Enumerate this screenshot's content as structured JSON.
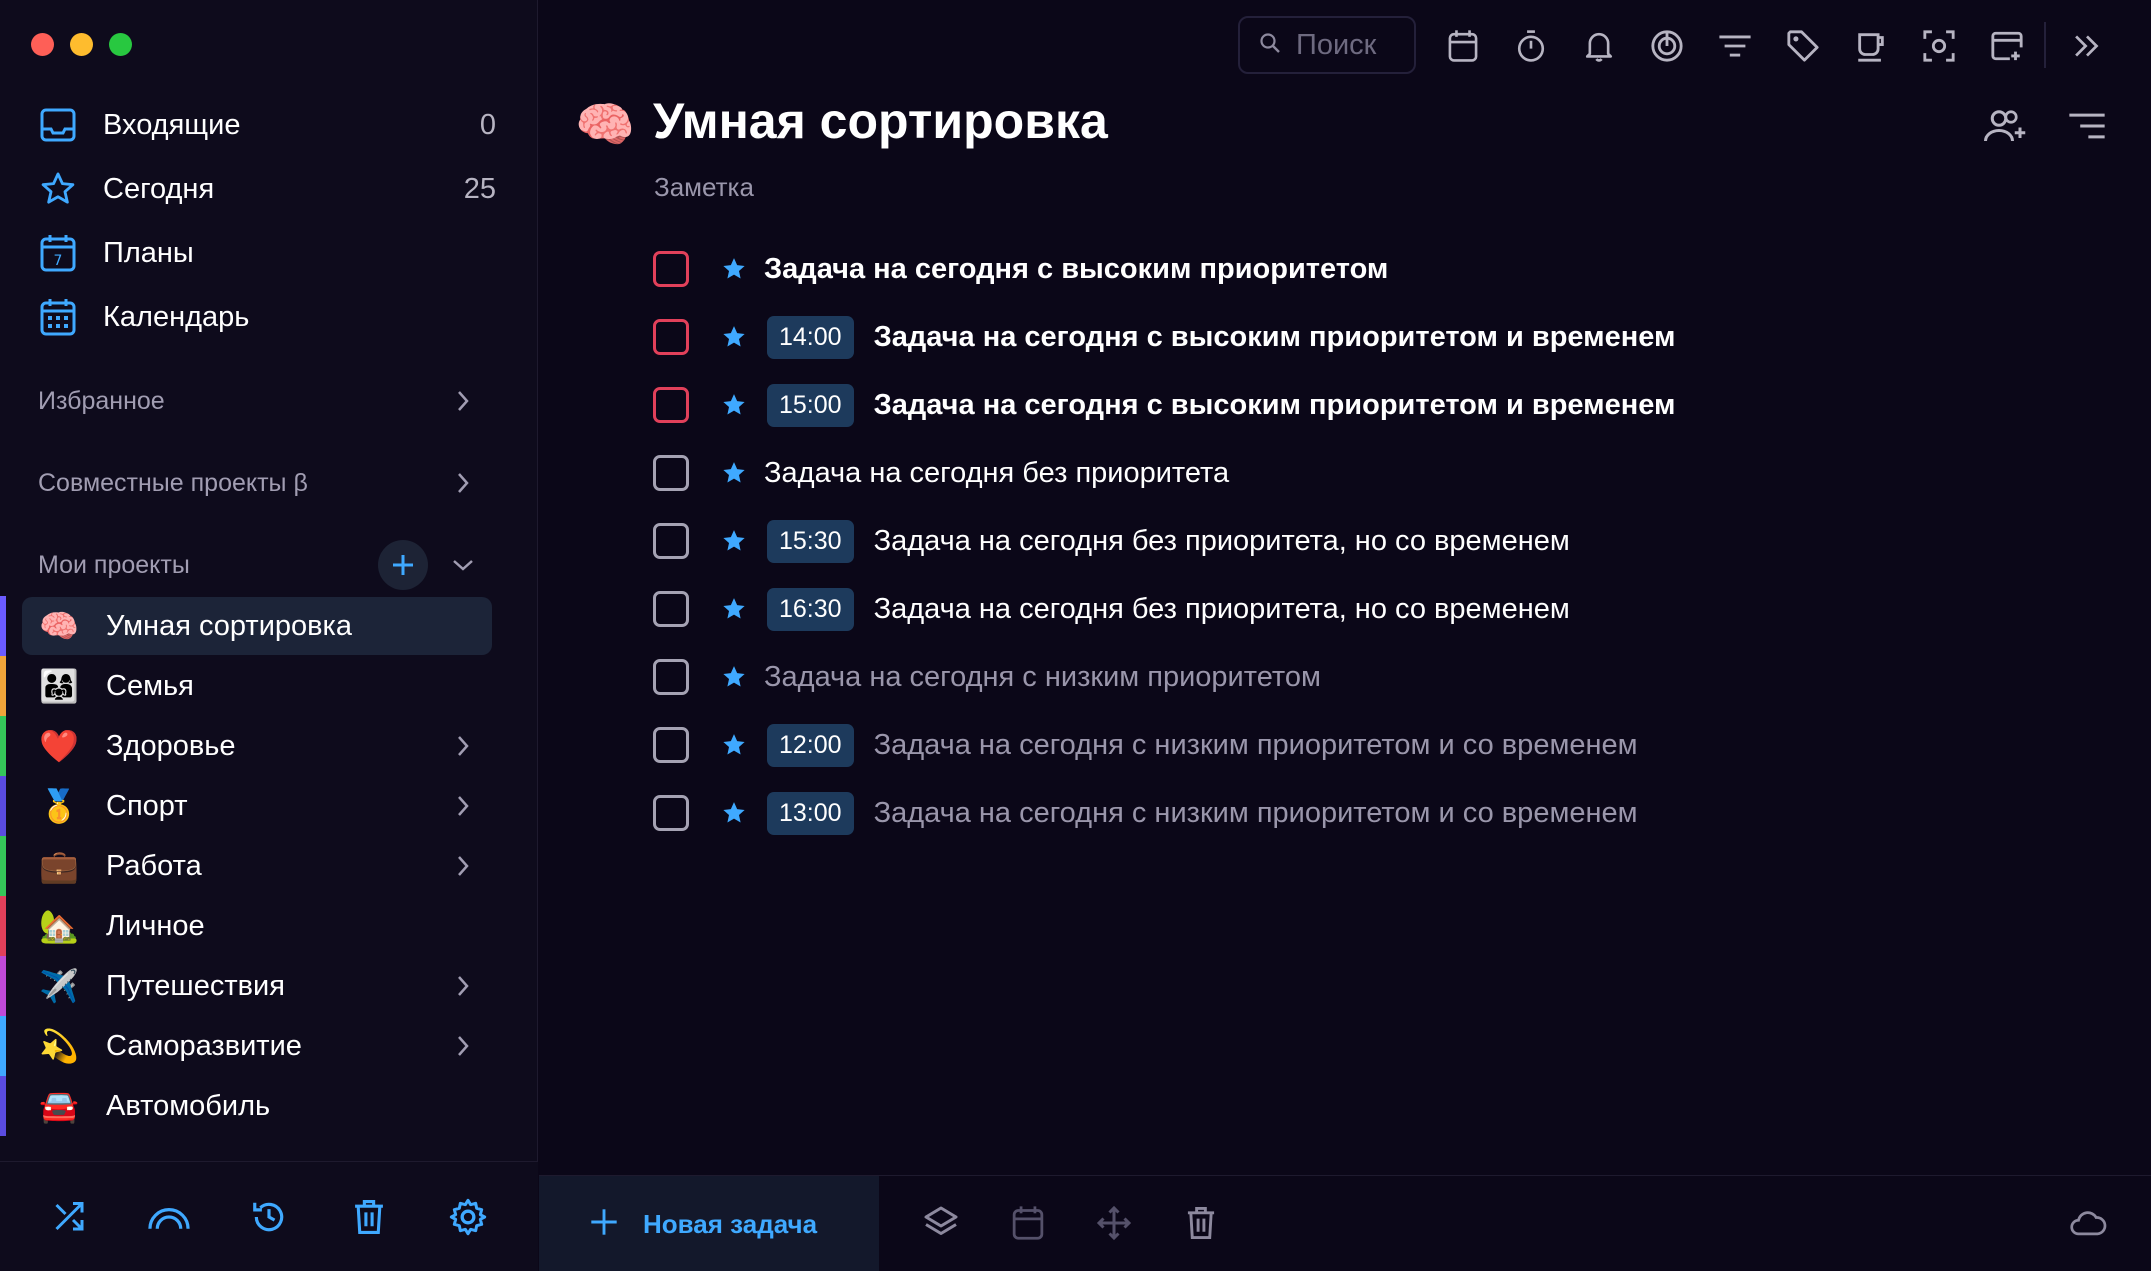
{
  "colors": {
    "accent": "#3fa9ff",
    "priority_high": "#e2405a",
    "time_badge": "#1d3a5c",
    "active_bg": "#1c2438"
  },
  "sidebar": {
    "nav": [
      {
        "label": "Входящие",
        "count": "0",
        "icon": "inbox-icon"
      },
      {
        "label": "Сегодня",
        "count": "25",
        "icon": "star-icon"
      },
      {
        "label": "Планы",
        "count": "",
        "icon": "planner-calendar-icon"
      },
      {
        "label": "Календарь",
        "count": "",
        "icon": "calendar-grid-icon"
      }
    ],
    "favorites_label": "Избранное",
    "shared_label": "Совместные проекты β",
    "my_projects_label": "Мои проекты",
    "projects": [
      {
        "emoji": "🧠",
        "label": "Умная сортировка",
        "color": "#6b5cff",
        "has_children": false,
        "active": true
      },
      {
        "emoji": "👨‍👩‍👧",
        "label": "Семья",
        "color": "#f0a53a",
        "has_children": false,
        "active": false
      },
      {
        "emoji": "❤️",
        "label": "Здоровье",
        "color": "#35c759",
        "has_children": true,
        "active": false
      },
      {
        "emoji": "🥇",
        "label": "Спорт",
        "color": "#5a4ce0",
        "has_children": true,
        "active": false
      },
      {
        "emoji": "💼",
        "label": "Работа",
        "color": "#35c759",
        "has_children": true,
        "active": false
      },
      {
        "emoji": "🏡",
        "label": "Личное",
        "color": "#e2405a",
        "has_children": false,
        "active": false
      },
      {
        "emoji": "✈️",
        "label": "Путешествия",
        "color": "#c04ad8",
        "has_children": true,
        "active": false
      },
      {
        "emoji": "💫",
        "label": "Саморазвитие",
        "color": "#3fa9ff",
        "has_children": true,
        "active": false
      },
      {
        "emoji": "🚘",
        "label": "Автомобиль",
        "color": "#5a4ce0",
        "has_children": false,
        "active": false
      }
    ],
    "bottom_icons": [
      "shuffle-icon",
      "rainbow-icon",
      "history-icon",
      "trash-icon",
      "settings-gear-icon"
    ]
  },
  "toolbar": {
    "search_placeholder": "Поиск",
    "icons": [
      "calendar-icon",
      "timer-icon",
      "bell-icon",
      "focus-icon",
      "filter-icon",
      "tag-icon",
      "coffee-cup-icon",
      "screenshot-icon",
      "add-calendar-icon",
      "expand-panel-icon"
    ]
  },
  "project": {
    "emoji": "🧠",
    "title": "Умная сортировка",
    "note": "Заметка",
    "tasks": [
      {
        "time": "",
        "text": "Задача на сегодня с высоким приоритетом",
        "priority": "high"
      },
      {
        "time": "14:00",
        "text": "Задача на сегодня с высоким приоритетом и временем",
        "priority": "high"
      },
      {
        "time": "15:00",
        "text": "Задача на сегодня с высоким приоритетом и временем",
        "priority": "high"
      },
      {
        "time": "",
        "text": "Задача на сегодня без приоритета",
        "priority": "none"
      },
      {
        "time": "15:30",
        "text": "Задача на сегодня без приоритета, но со временем",
        "priority": "none"
      },
      {
        "time": "16:30",
        "text": "Задача на сегодня без приоритета, но со временем",
        "priority": "none"
      },
      {
        "time": "",
        "text": "Задача на сегодня с низким приоритетом",
        "priority": "low"
      },
      {
        "time": "12:00",
        "text": "Задача на сегодня с низким приоритетом и со временем",
        "priority": "low"
      },
      {
        "time": "13:00",
        "text": "Задача на сегодня с низким приоритетом и со временем",
        "priority": "low"
      }
    ]
  },
  "bottom_bar": {
    "new_task_label": "Новая задача"
  }
}
